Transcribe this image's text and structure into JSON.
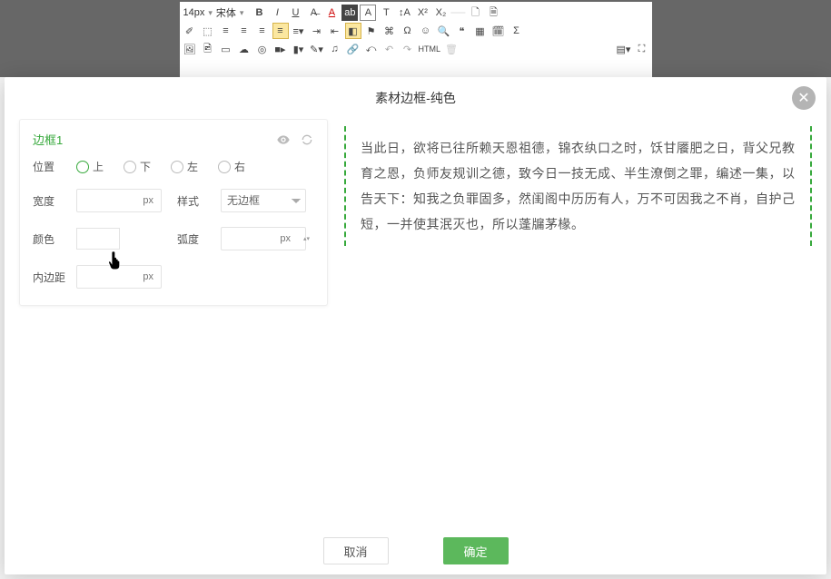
{
  "toolbar": {
    "font_size": "14px",
    "font_family": "宋体",
    "html_label": "HTML"
  },
  "modal": {
    "title": "素材边框-纯色",
    "cancel": "取消",
    "confirm": "确定"
  },
  "panel": {
    "title": "边框1",
    "labels": {
      "position": "位置",
      "width": "宽度",
      "style": "样式",
      "color": "颜色",
      "radius": "弧度",
      "padding": "内边距"
    },
    "position_options": {
      "top": "上",
      "bottom": "下",
      "left": "左",
      "right": "右"
    },
    "style_value": "无边框",
    "unit_px": "px",
    "unit_px_dd": "px"
  },
  "preview": {
    "text": "当此日，欲将已往所赖天恩祖德，锦衣纨口之时，饫甘餍肥之日，背父兄教育之恩，负师友规训之德，致今日一技无成、半生潦倒之罪，编述一集，以告天下：知我之负罪固多，然闺阁中历历有人，万不可因我之不肖，自护己短，一并使其泯灭也，所以蓬牖茅椽。"
  }
}
